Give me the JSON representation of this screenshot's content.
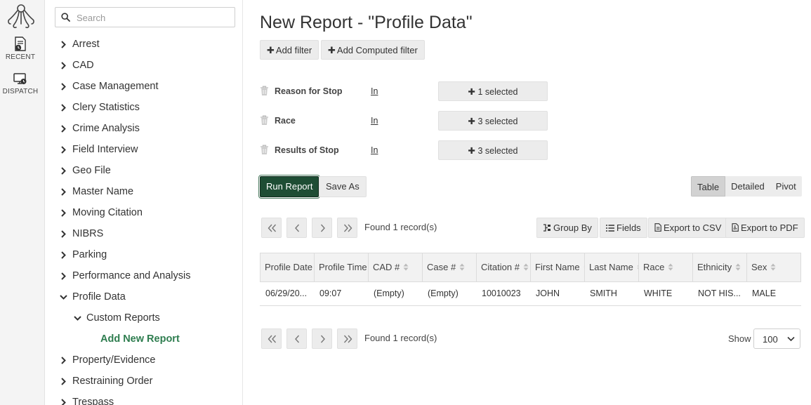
{
  "rail": {
    "items": [
      {
        "label": "RECENT",
        "icon": "recent-report-icon"
      },
      {
        "label": "DISPATCH",
        "icon": "dispatch-monitor-icon"
      }
    ]
  },
  "sidebar": {
    "search_placeholder": "Search",
    "items": [
      {
        "label": "Arrest",
        "level": 0,
        "expanded": false
      },
      {
        "label": "CAD",
        "level": 0,
        "expanded": false
      },
      {
        "label": "Case Management",
        "level": 0,
        "expanded": false
      },
      {
        "label": "Clery Statistics",
        "level": 0,
        "expanded": false
      },
      {
        "label": "Crime Analysis",
        "level": 0,
        "expanded": false
      },
      {
        "label": "Field Interview",
        "level": 0,
        "expanded": false
      },
      {
        "label": "Geo File",
        "level": 0,
        "expanded": false
      },
      {
        "label": "Master Name",
        "level": 0,
        "expanded": false
      },
      {
        "label": "Moving Citation",
        "level": 0,
        "expanded": false
      },
      {
        "label": "NIBRS",
        "level": 0,
        "expanded": false
      },
      {
        "label": "Parking",
        "level": 0,
        "expanded": false
      },
      {
        "label": "Performance and Analysis",
        "level": 0,
        "expanded": false
      },
      {
        "label": "Profile Data",
        "level": 0,
        "expanded": true
      },
      {
        "label": "Custom Reports",
        "level": 1,
        "expanded": true
      },
      {
        "label": "Add New Report",
        "level": 2,
        "active": true
      },
      {
        "label": "Property/Evidence",
        "level": 0,
        "expanded": false
      },
      {
        "label": "Restraining Order",
        "level": 0,
        "expanded": false
      },
      {
        "label": "Trespass",
        "level": 0,
        "expanded": false
      }
    ]
  },
  "main": {
    "title": "New Report - \"Profile Data\"",
    "add_filter_label": "Add filter",
    "add_computed_filter_label": "Add Computed filter",
    "filters": [
      {
        "name": "Reason for Stop",
        "operator": "In",
        "selection": "1 selected"
      },
      {
        "name": "Race",
        "operator": "In",
        "selection": "3 selected"
      },
      {
        "name": "Results of Stop",
        "operator": "In",
        "selection": "3 selected"
      }
    ],
    "run_report_label": "Run Report",
    "save_as_label": "Save As",
    "view_modes": [
      {
        "label": "Table",
        "active": true
      },
      {
        "label": "Detailed",
        "active": false
      },
      {
        "label": "Pivot",
        "active": false
      }
    ],
    "found_text": "Found 1 record(s)",
    "toolbar": {
      "group_by": "Group By",
      "fields": "Fields",
      "export_csv": "Export to CSV",
      "export_pdf": "Export to PDF"
    },
    "table": {
      "columns": [
        "Profile Date",
        "Profile Time",
        "CAD #",
        "Case #",
        "Citation #",
        "First Name",
        "Last Name",
        "Race",
        "Ethnicity",
        "Sex"
      ],
      "rows": [
        [
          "06/29/20...",
          "09:07",
          "(Empty)",
          "(Empty)",
          "10010023",
          "JOHN",
          "SMITH",
          "WHITE",
          "NOT HIS...",
          "MALE"
        ]
      ]
    },
    "show_label": "Show",
    "page_size": "100"
  },
  "colors": {
    "accent_green": "#2e7d4f",
    "run_button": "#1e4d34"
  }
}
